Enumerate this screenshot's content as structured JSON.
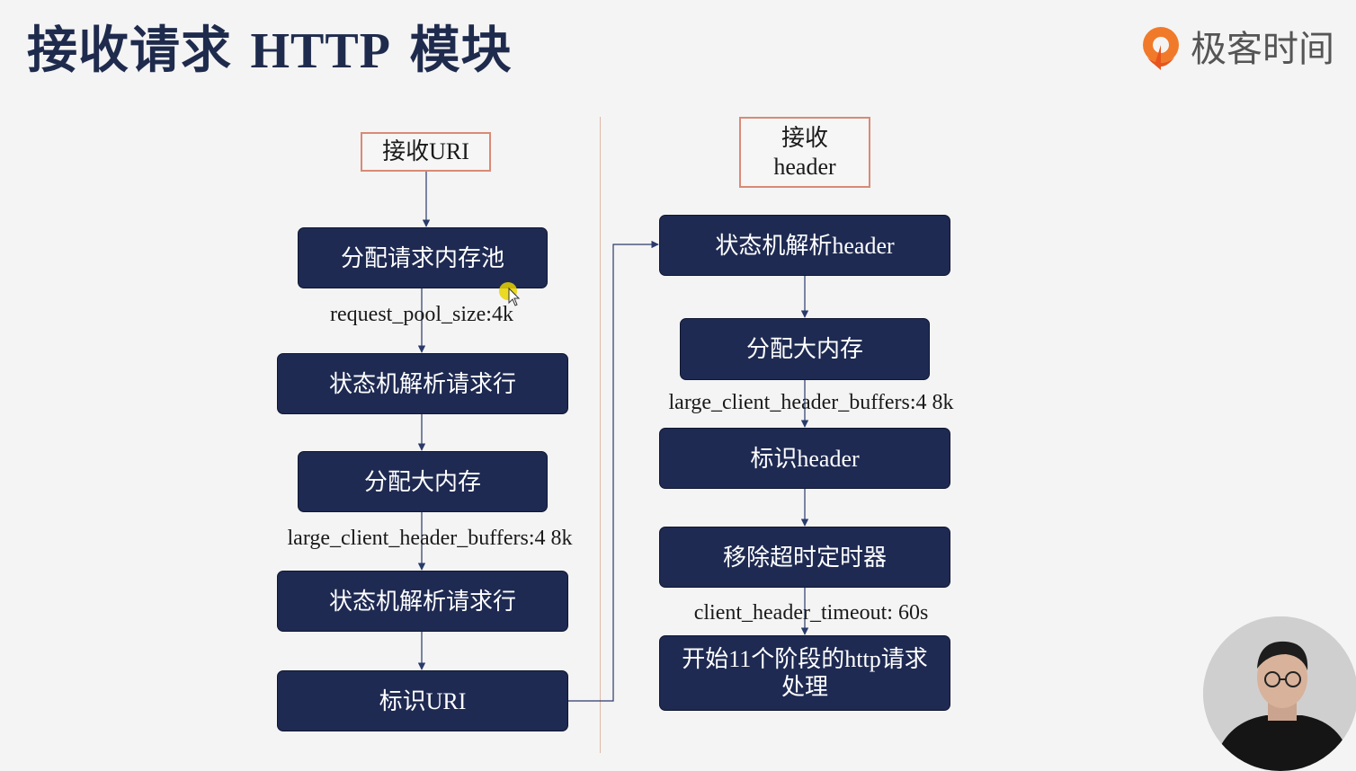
{
  "title": {
    "cn_a": "接收请求 ",
    "en": "HTTP",
    "cn_b": " 模块"
  },
  "logo": {
    "text": "极客时间",
    "icon": "geekbang-logo-icon"
  },
  "left": {
    "start": "接收URI",
    "nodes": [
      "分配请求内存池",
      "状态机解析请求行",
      "分配大内存",
      "状态机解析请求行",
      "标识URI"
    ],
    "labels": [
      "request_pool_size:4k",
      "large_client_header_buffers:4 8k"
    ]
  },
  "right": {
    "start_line1": "接收",
    "start_line2": "header",
    "nodes": [
      "状态机解析header",
      "分配大内存",
      "标识header",
      "移除超时定时器",
      "开始11个阶段的http请求处理"
    ],
    "labels": [
      "large_client_header_buffers:4 8k",
      "client_header_timeout: 60s"
    ]
  },
  "colors": {
    "node_fill": "#1e2a52",
    "start_border": "#d98a76",
    "connector": "#2a3a6a",
    "title": "#1f2b4d"
  }
}
